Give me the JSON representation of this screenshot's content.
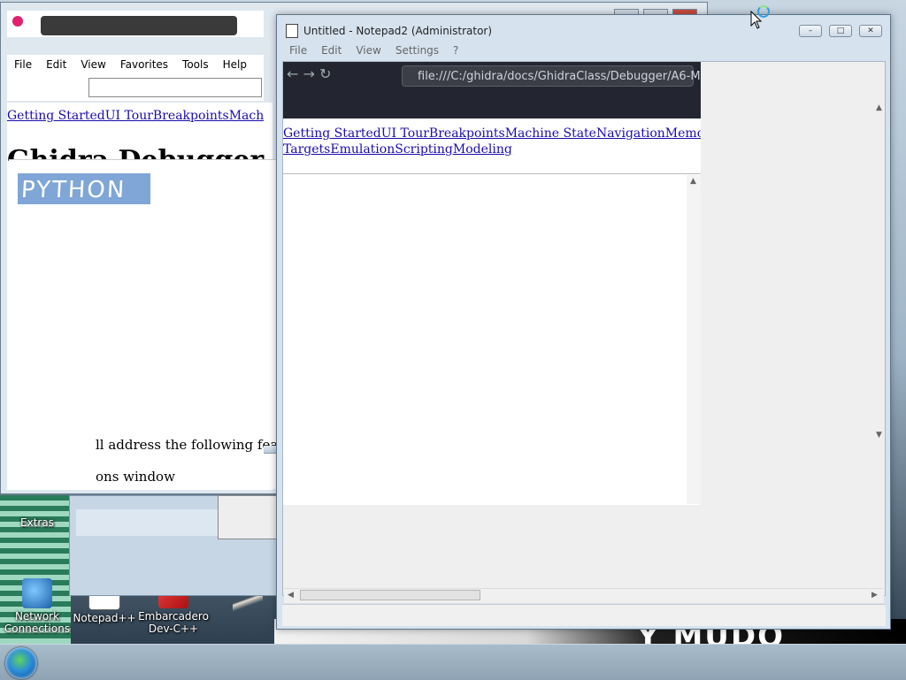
{
  "browser": {
    "menu": [
      "File",
      "Edit",
      "View",
      "Favorites",
      "Tools",
      "Help"
    ],
    "nav_links_left": "Getting StartedUI TourBreakpointsMachine S",
    "heading_fragment": "Ghidra Debugger",
    "body_fragment_1": "ll address the following featu",
    "body_fragment_2": "ons window"
  },
  "paint": {
    "selected_text": "PYTHON"
  },
  "notepad": {
    "title": "Untitled - Notepad2 (Administrator)",
    "menu": [
      "File",
      "Edit",
      "View",
      "Settings",
      "?"
    ],
    "caption_buttons": {
      "minimize": "–",
      "maximize": "□",
      "close": "✕"
    }
  },
  "background_browser": {
    "url": "file:///C:/ghidra/docs/GhidraClass/Debugger/A6-M",
    "links_line1": "Getting StartedUI TourBreakpointsMachine StateNavigationMemory MapI",
    "links_line2": "TargetsEmulationScriptingModeling"
  },
  "desktop": {
    "icons": [
      {
        "label": "Extras"
      },
      {
        "label": "Network\nConnections"
      },
      {
        "label": "Notepad++"
      },
      {
        "label": "Embarcadero\nDev-C++"
      }
    ]
  },
  "colors": {
    "link": "#1a0dab",
    "selection": "#7fa6d6",
    "taskbar": "#9eb2c3"
  }
}
